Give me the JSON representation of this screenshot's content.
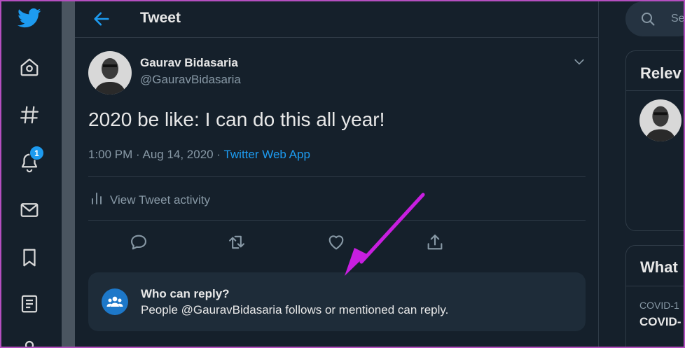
{
  "nav": {
    "notification_count": "1",
    "icons": [
      "twitter-logo",
      "home-icon",
      "explore-icon",
      "notifications-icon",
      "messages-icon",
      "bookmarks-icon",
      "lists-icon",
      "profile-icon"
    ]
  },
  "header": {
    "title": "Tweet"
  },
  "tweet": {
    "author_name": "Gaurav Bidasaria",
    "author_handle": "@GauravBidasaria",
    "text": "2020 be like: I can do this all year!",
    "timestamp": "1:00 PM · Aug 14, 2020 · ",
    "source": "Twitter Web App",
    "activity_label": "View Tweet activity"
  },
  "reply_settings": {
    "title": "Who can reply?",
    "description": "People @GauravBidasaria follows or mentioned can reply."
  },
  "sidebar": {
    "search_placeholder": "Se",
    "relevant_title": "Relev",
    "whats_happening_title": "What",
    "trend_category": "COVID-1",
    "trend_name": "COVID-"
  },
  "colors": {
    "background": "#15202b",
    "accent": "#1d9bf0",
    "annotation_arrow": "#c81ee0"
  }
}
